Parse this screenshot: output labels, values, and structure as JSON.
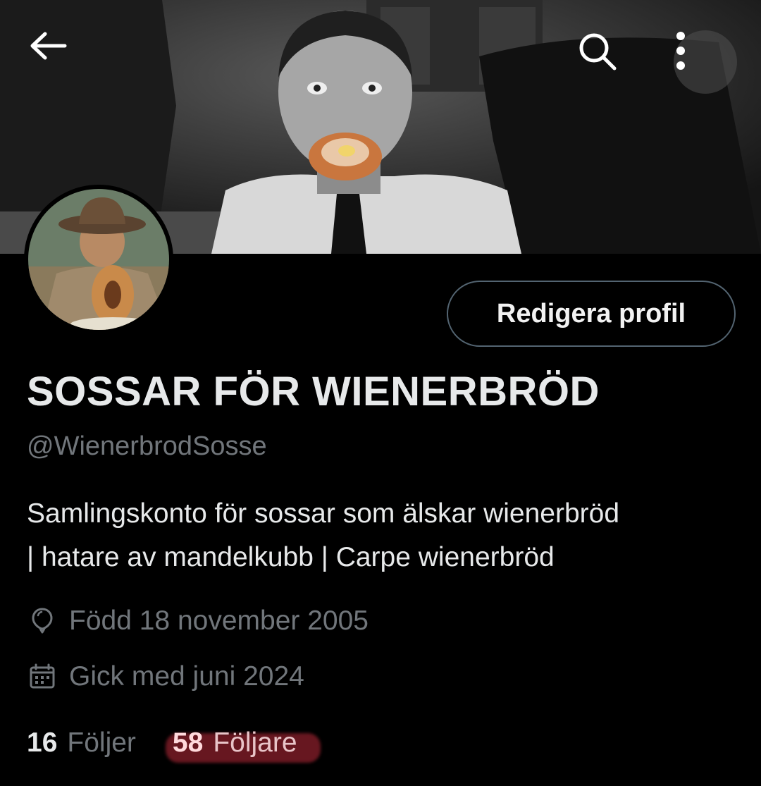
{
  "header": {
    "back_icon": "arrow-left-icon",
    "search_icon": "search-icon",
    "more_icon": "more-vertical-icon"
  },
  "profile": {
    "edit_button_label": "Redigera profil",
    "display_name": "SOSSAR FÖR WIENERBRÖD",
    "handle": "@WienerbrodSosse",
    "bio_line_1": "Samlingskonto för sossar som älskar wienerbröd",
    "bio_line_2": "| hatare av mandelkubb |  Carpe wienerbröd",
    "born": "Född 18 november 2005",
    "joined": "Gick med juni 2024",
    "following_count": "16",
    "following_label": "Följer",
    "followers_count": "58",
    "followers_label": "Följare"
  },
  "colors": {
    "background": "#000000",
    "text_primary": "#e7e9ea",
    "text_secondary": "#71767b",
    "button_border": "#536471",
    "followers_highlight": "#8a1f2b"
  }
}
